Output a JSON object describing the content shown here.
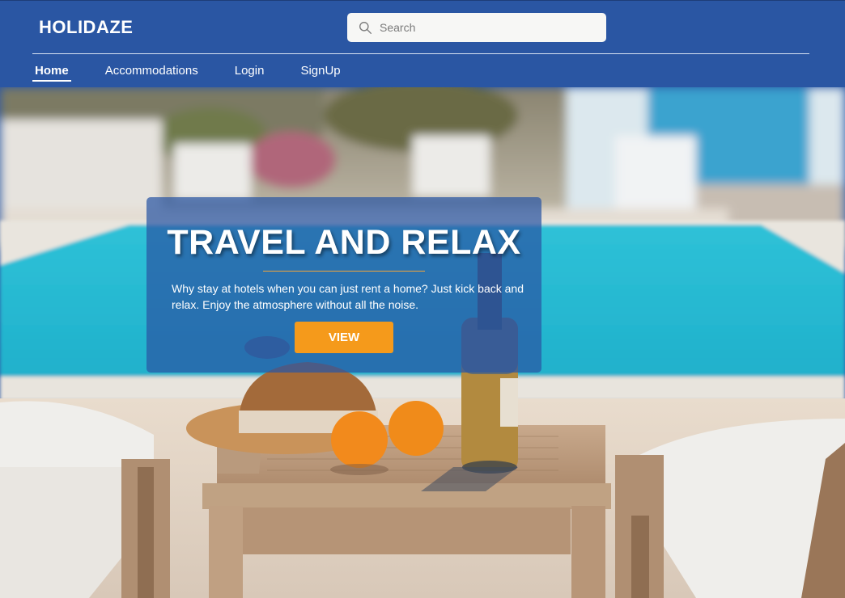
{
  "header": {
    "logo": "HOLIDAZE",
    "search": {
      "placeholder": "Search",
      "icon": "search-icon"
    },
    "nav": [
      {
        "label": "Home",
        "active": true
      },
      {
        "label": "Accommodations",
        "active": false
      },
      {
        "label": "Login",
        "active": false
      },
      {
        "label": "SignUp",
        "active": false
      }
    ]
  },
  "hero": {
    "title": "TRAVEL AND RELAX",
    "description": "Why stay at hotels when you can just rent a home? Just kick back and relax. Enjoy the atmosphere without all the noise.",
    "cta_label": "VIEW"
  },
  "colors": {
    "primary": "#2a56a3",
    "accent": "#f59a1b",
    "text_light": "#ffffff"
  }
}
